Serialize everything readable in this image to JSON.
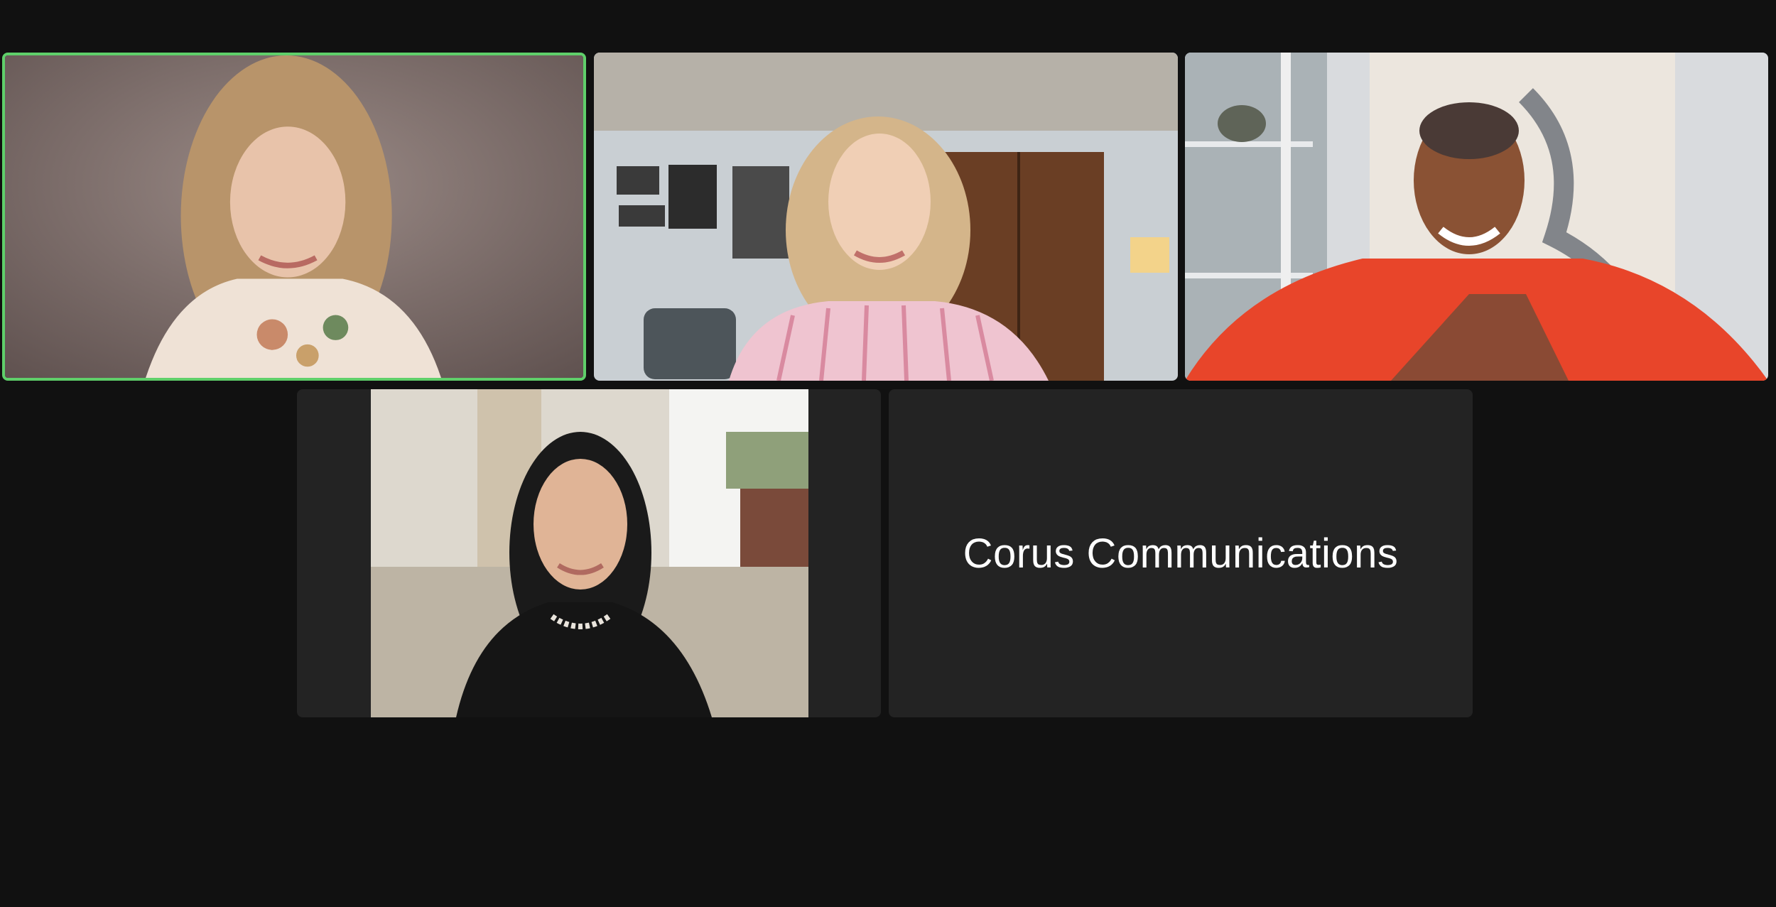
{
  "meeting": {
    "view": "gallery",
    "participant_count": 5,
    "active_speaker_index": 0
  },
  "participants": [
    {
      "kind": "video",
      "icon": "participant-video-icon",
      "highlight_color": "#5fcf6a"
    },
    {
      "kind": "video",
      "icon": "participant-video-icon"
    },
    {
      "kind": "video",
      "icon": "participant-video-icon"
    },
    {
      "kind": "video",
      "icon": "participant-video-icon"
    },
    {
      "kind": "name",
      "display_name": "Corus Communications"
    }
  ],
  "colors": {
    "background": "#111111",
    "tile_background": "#232323",
    "active_speaker_border": "#5fcf6a",
    "name_text": "#ffffff"
  }
}
